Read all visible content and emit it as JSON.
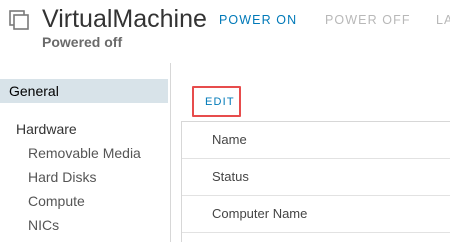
{
  "header": {
    "title": "VirtualMachine",
    "status": "Powered off",
    "actions": [
      {
        "label": "POWER ON",
        "enabled": true
      },
      {
        "label": "POWER OFF",
        "enabled": false
      },
      {
        "label": "LA",
        "enabled": false
      }
    ],
    "icon": "vm-icon"
  },
  "sidebar": {
    "selected": "General",
    "general_label": "General",
    "hardware_label": "Hardware",
    "hardware_items": [
      {
        "label": "Removable Media"
      },
      {
        "label": "Hard Disks"
      },
      {
        "label": "Compute"
      },
      {
        "label": "NICs"
      }
    ]
  },
  "main": {
    "edit_label": "EDIT",
    "rows": [
      {
        "label": "Name"
      },
      {
        "label": "Status"
      },
      {
        "label": "Computer Name"
      }
    ]
  },
  "colors": {
    "accent": "#0079b8",
    "disabled": "#b8b8b8",
    "selected_bg": "#d8e3e9",
    "highlight": "#e74c4c"
  }
}
